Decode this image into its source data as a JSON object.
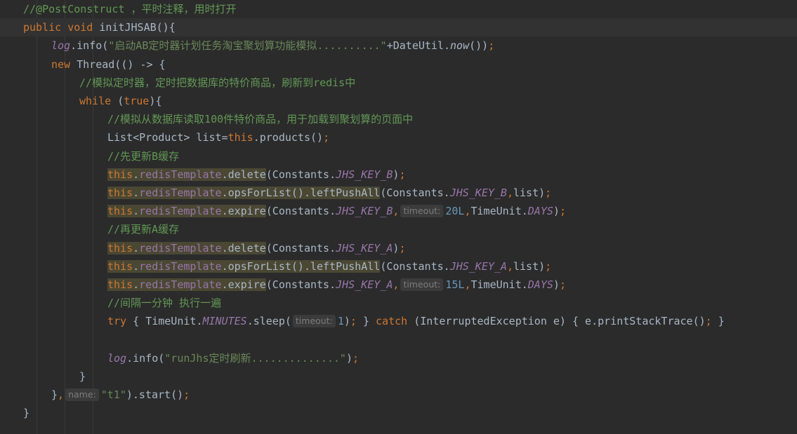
{
  "editor": {
    "lines": [
      {
        "tokens": [
          {
            "t": "//@PostConstruct ，平时注释，用时打开",
            "c": "tok-cm"
          }
        ]
      },
      {
        "tokens": [
          {
            "t": "public ",
            "c": "tok-kw"
          },
          {
            "t": "void ",
            "c": "tok-kw"
          },
          {
            "t": "initJHSAB",
            "c": "tok-fn"
          },
          {
            "t": "(){",
            "c": ""
          }
        ]
      },
      {
        "tokens": [
          {
            "t": "log",
            "c": "tok-static"
          },
          {
            "t": ".info(",
            "c": ""
          },
          {
            "t": "\"启动AB定时器计划任务淘宝聚划算功能模拟..........\"",
            "c": "tok-str"
          },
          {
            "t": "+DateUtil.",
            "c": ""
          },
          {
            "t": "now",
            "c": "tok-italic"
          },
          {
            "t": "())",
            "c": ""
          },
          {
            "t": ";",
            "c": "tok-kw"
          }
        ]
      },
      {
        "tokens": [
          {
            "t": "new ",
            "c": "tok-kw"
          },
          {
            "t": "Thread(() -> {",
            "c": ""
          }
        ]
      },
      {
        "tokens": [
          {
            "t": "//模拟定时器，定时把数据库的特价商品，刷新到redis中",
            "c": "tok-cm"
          }
        ]
      },
      {
        "tokens": [
          {
            "t": "while ",
            "c": "tok-kw"
          },
          {
            "t": "(",
            "c": ""
          },
          {
            "t": "true",
            "c": "tok-kw"
          },
          {
            "t": "){",
            "c": ""
          }
        ]
      },
      {
        "tokens": [
          {
            "t": "//模拟从数据库读取100件特价商品，用于加载到聚划算的页面中",
            "c": "tok-cm"
          }
        ]
      },
      {
        "tokens": [
          {
            "t": "List<Product> list=",
            "c": ""
          },
          {
            "t": "this",
            "c": "tok-kw"
          },
          {
            "t": ".products()",
            "c": ""
          },
          {
            "t": ";",
            "c": "tok-kw"
          }
        ]
      },
      {
        "tokens": [
          {
            "t": "//先更新B缓存",
            "c": "tok-cm"
          }
        ]
      },
      {
        "tokens": [
          {
            "t": "this",
            "c": "tok-kw hl"
          },
          {
            "t": ".",
            "c": "hl"
          },
          {
            "t": "redisTemplate",
            "c": "tok-field hl"
          },
          {
            "t": ".delete",
            "c": "hl"
          },
          {
            "t": "(Constants.",
            "c": ""
          },
          {
            "t": "JHS_KEY_B",
            "c": "tok-static"
          },
          {
            "t": ")",
            "c": ""
          },
          {
            "t": ";",
            "c": "tok-kw"
          }
        ]
      },
      {
        "tokens": [
          {
            "t": "this",
            "c": "tok-kw hl"
          },
          {
            "t": ".",
            "c": "hl"
          },
          {
            "t": "redisTemplate",
            "c": "tok-field hl"
          },
          {
            "t": ".opsForList().leftPushAll",
            "c": "hl"
          },
          {
            "t": "(Constants.",
            "c": ""
          },
          {
            "t": "JHS_KEY_B",
            "c": "tok-static"
          },
          {
            "t": ",",
            "c": "tok-kw"
          },
          {
            "t": "list)",
            "c": ""
          },
          {
            "t": ";",
            "c": "tok-kw"
          }
        ]
      },
      {
        "tokens": [
          {
            "t": "this",
            "c": "tok-kw hl"
          },
          {
            "t": ".",
            "c": "hl"
          },
          {
            "t": "redisTemplate",
            "c": "tok-field hl"
          },
          {
            "t": ".expire",
            "c": "hl"
          },
          {
            "t": "(Constants.",
            "c": ""
          },
          {
            "t": "JHS_KEY_B",
            "c": "tok-static"
          },
          {
            "t": ",",
            "c": "tok-kw"
          },
          {
            "hint": "timeout:"
          },
          {
            "t": "20L",
            "c": "tok-num"
          },
          {
            "t": ",",
            "c": "tok-kw"
          },
          {
            "t": "TimeUnit.",
            "c": ""
          },
          {
            "t": "DAYS",
            "c": "tok-static"
          },
          {
            "t": ")",
            "c": ""
          },
          {
            "t": ";",
            "c": "tok-kw"
          }
        ]
      },
      {
        "tokens": [
          {
            "t": "//再更新A缓存",
            "c": "tok-cm"
          }
        ]
      },
      {
        "tokens": [
          {
            "t": "this",
            "c": "tok-kw hl"
          },
          {
            "t": ".",
            "c": "hl"
          },
          {
            "t": "redisTemplate",
            "c": "tok-field hl"
          },
          {
            "t": ".delete",
            "c": "hl"
          },
          {
            "t": "(Constants.",
            "c": ""
          },
          {
            "t": "JHS_KEY_A",
            "c": "tok-static"
          },
          {
            "t": ")",
            "c": ""
          },
          {
            "t": ";",
            "c": "tok-kw"
          }
        ]
      },
      {
        "tokens": [
          {
            "t": "this",
            "c": "tok-kw hl"
          },
          {
            "t": ".",
            "c": "hl"
          },
          {
            "t": "redisTemplate",
            "c": "tok-field hl"
          },
          {
            "t": ".opsForList().leftPushAll",
            "c": "hl"
          },
          {
            "t": "(Constants.",
            "c": ""
          },
          {
            "t": "JHS_KEY_A",
            "c": "tok-static"
          },
          {
            "t": ",",
            "c": "tok-kw"
          },
          {
            "t": "list)",
            "c": ""
          },
          {
            "t": ";",
            "c": "tok-kw"
          }
        ]
      },
      {
        "tokens": [
          {
            "t": "this",
            "c": "tok-kw hl"
          },
          {
            "t": ".",
            "c": "hl"
          },
          {
            "t": "redisTemplate",
            "c": "tok-field hl"
          },
          {
            "t": ".expire",
            "c": "hl"
          },
          {
            "t": "(Constants.",
            "c": ""
          },
          {
            "t": "JHS_KEY_A",
            "c": "tok-static"
          },
          {
            "t": ",",
            "c": "tok-kw"
          },
          {
            "hint": "timeout:"
          },
          {
            "t": "15L",
            "c": "tok-num"
          },
          {
            "t": ",",
            "c": "tok-kw"
          },
          {
            "t": "TimeUnit.",
            "c": ""
          },
          {
            "t": "DAYS",
            "c": "tok-static"
          },
          {
            "t": ")",
            "c": ""
          },
          {
            "t": ";",
            "c": "tok-kw"
          }
        ]
      },
      {
        "tokens": [
          {
            "t": "//间隔一分钟 执行一遍",
            "c": "tok-cm"
          }
        ]
      },
      {
        "tokens": [
          {
            "t": "try ",
            "c": "tok-kw"
          },
          {
            "t": "{ TimeUnit.",
            "c": ""
          },
          {
            "t": "MINUTES",
            "c": "tok-static"
          },
          {
            "t": ".sleep(",
            "c": ""
          },
          {
            "hint": "timeout:"
          },
          {
            "t": "1",
            "c": "tok-num"
          },
          {
            "t": ")",
            "c": ""
          },
          {
            "t": ";",
            "c": "tok-kw"
          },
          {
            "t": " } ",
            "c": ""
          },
          {
            "t": "catch ",
            "c": "tok-kw"
          },
          {
            "t": "(InterruptedException e) { e.printStackTrace()",
            "c": ""
          },
          {
            "t": "; ",
            "c": "tok-kw"
          },
          {
            "t": "}",
            "c": ""
          }
        ]
      },
      {
        "tokens": []
      },
      {
        "tokens": [
          {
            "t": "log",
            "c": "tok-static"
          },
          {
            "t": ".info(",
            "c": ""
          },
          {
            "t": "\"runJhs定时刷新..............\"",
            "c": "tok-str"
          },
          {
            "t": ")",
            "c": ""
          },
          {
            "t": ";",
            "c": "tok-kw"
          }
        ]
      },
      {
        "tokens": [
          {
            "t": "}",
            "c": ""
          }
        ]
      },
      {
        "tokens": [
          {
            "t": "}",
            "c": ""
          },
          {
            "t": ",",
            "c": "tok-kw"
          },
          {
            "hint": "name:"
          },
          {
            "t": "\"t1\"",
            "c": "tok-str"
          },
          {
            "t": ").start()",
            "c": ""
          },
          {
            "t": ";",
            "c": "tok-kw"
          }
        ]
      },
      {
        "tokens": [
          {
            "t": "}",
            "c": ""
          }
        ]
      }
    ]
  }
}
